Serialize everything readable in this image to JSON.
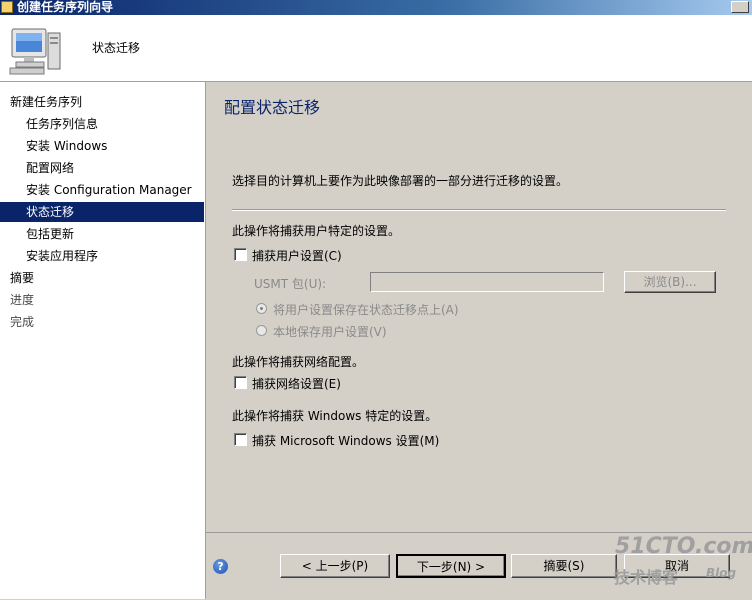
{
  "window": {
    "title": "创建任务序列向导"
  },
  "header": {
    "title": "状态迁移"
  },
  "sidebar": {
    "items": [
      {
        "label": "新建任务序列"
      },
      {
        "label": "任务序列信息"
      },
      {
        "label": "安装 Windows"
      },
      {
        "label": "配置网络"
      },
      {
        "label": "安装 Configuration Manager"
      },
      {
        "label": "状态迁移"
      },
      {
        "label": "包括更新"
      },
      {
        "label": "安装应用程序"
      },
      {
        "label": "摘要"
      },
      {
        "label": "进度"
      },
      {
        "label": "完成"
      }
    ]
  },
  "main": {
    "title": "配置状态迁移",
    "description": "选择目的计算机上要作为此映像部署的一部分进行迁移的设置。",
    "user_section": {
      "heading": "此操作将捕获用户特定的设置。",
      "capture_user_label": "捕获用户设置(C)",
      "usmt_label": "USMT 包(U):",
      "usmt_value": "",
      "browse_label": "浏览(B)...",
      "radio_state_point": "将用户设置保存在状态迁移点上(A)",
      "radio_local": "本地保存用户设置(V)"
    },
    "network_section": {
      "heading": "此操作将捕获网络配置。",
      "capture_network_label": "捕获网络设置(E)"
    },
    "windows_section": {
      "heading": "此操作将捕获 Windows 特定的设置。",
      "capture_windows_label": "捕获 Microsoft Windows 设置(M)"
    }
  },
  "footer": {
    "help": "?",
    "prev_label": "< 上一步(P)",
    "next_label": "下一步(N) >",
    "summary_label": "摘要(S)",
    "cancel_label": "取消"
  },
  "watermark": {
    "site": "51CTO.com",
    "sub": "技术博客",
    "blog": "Blog"
  }
}
